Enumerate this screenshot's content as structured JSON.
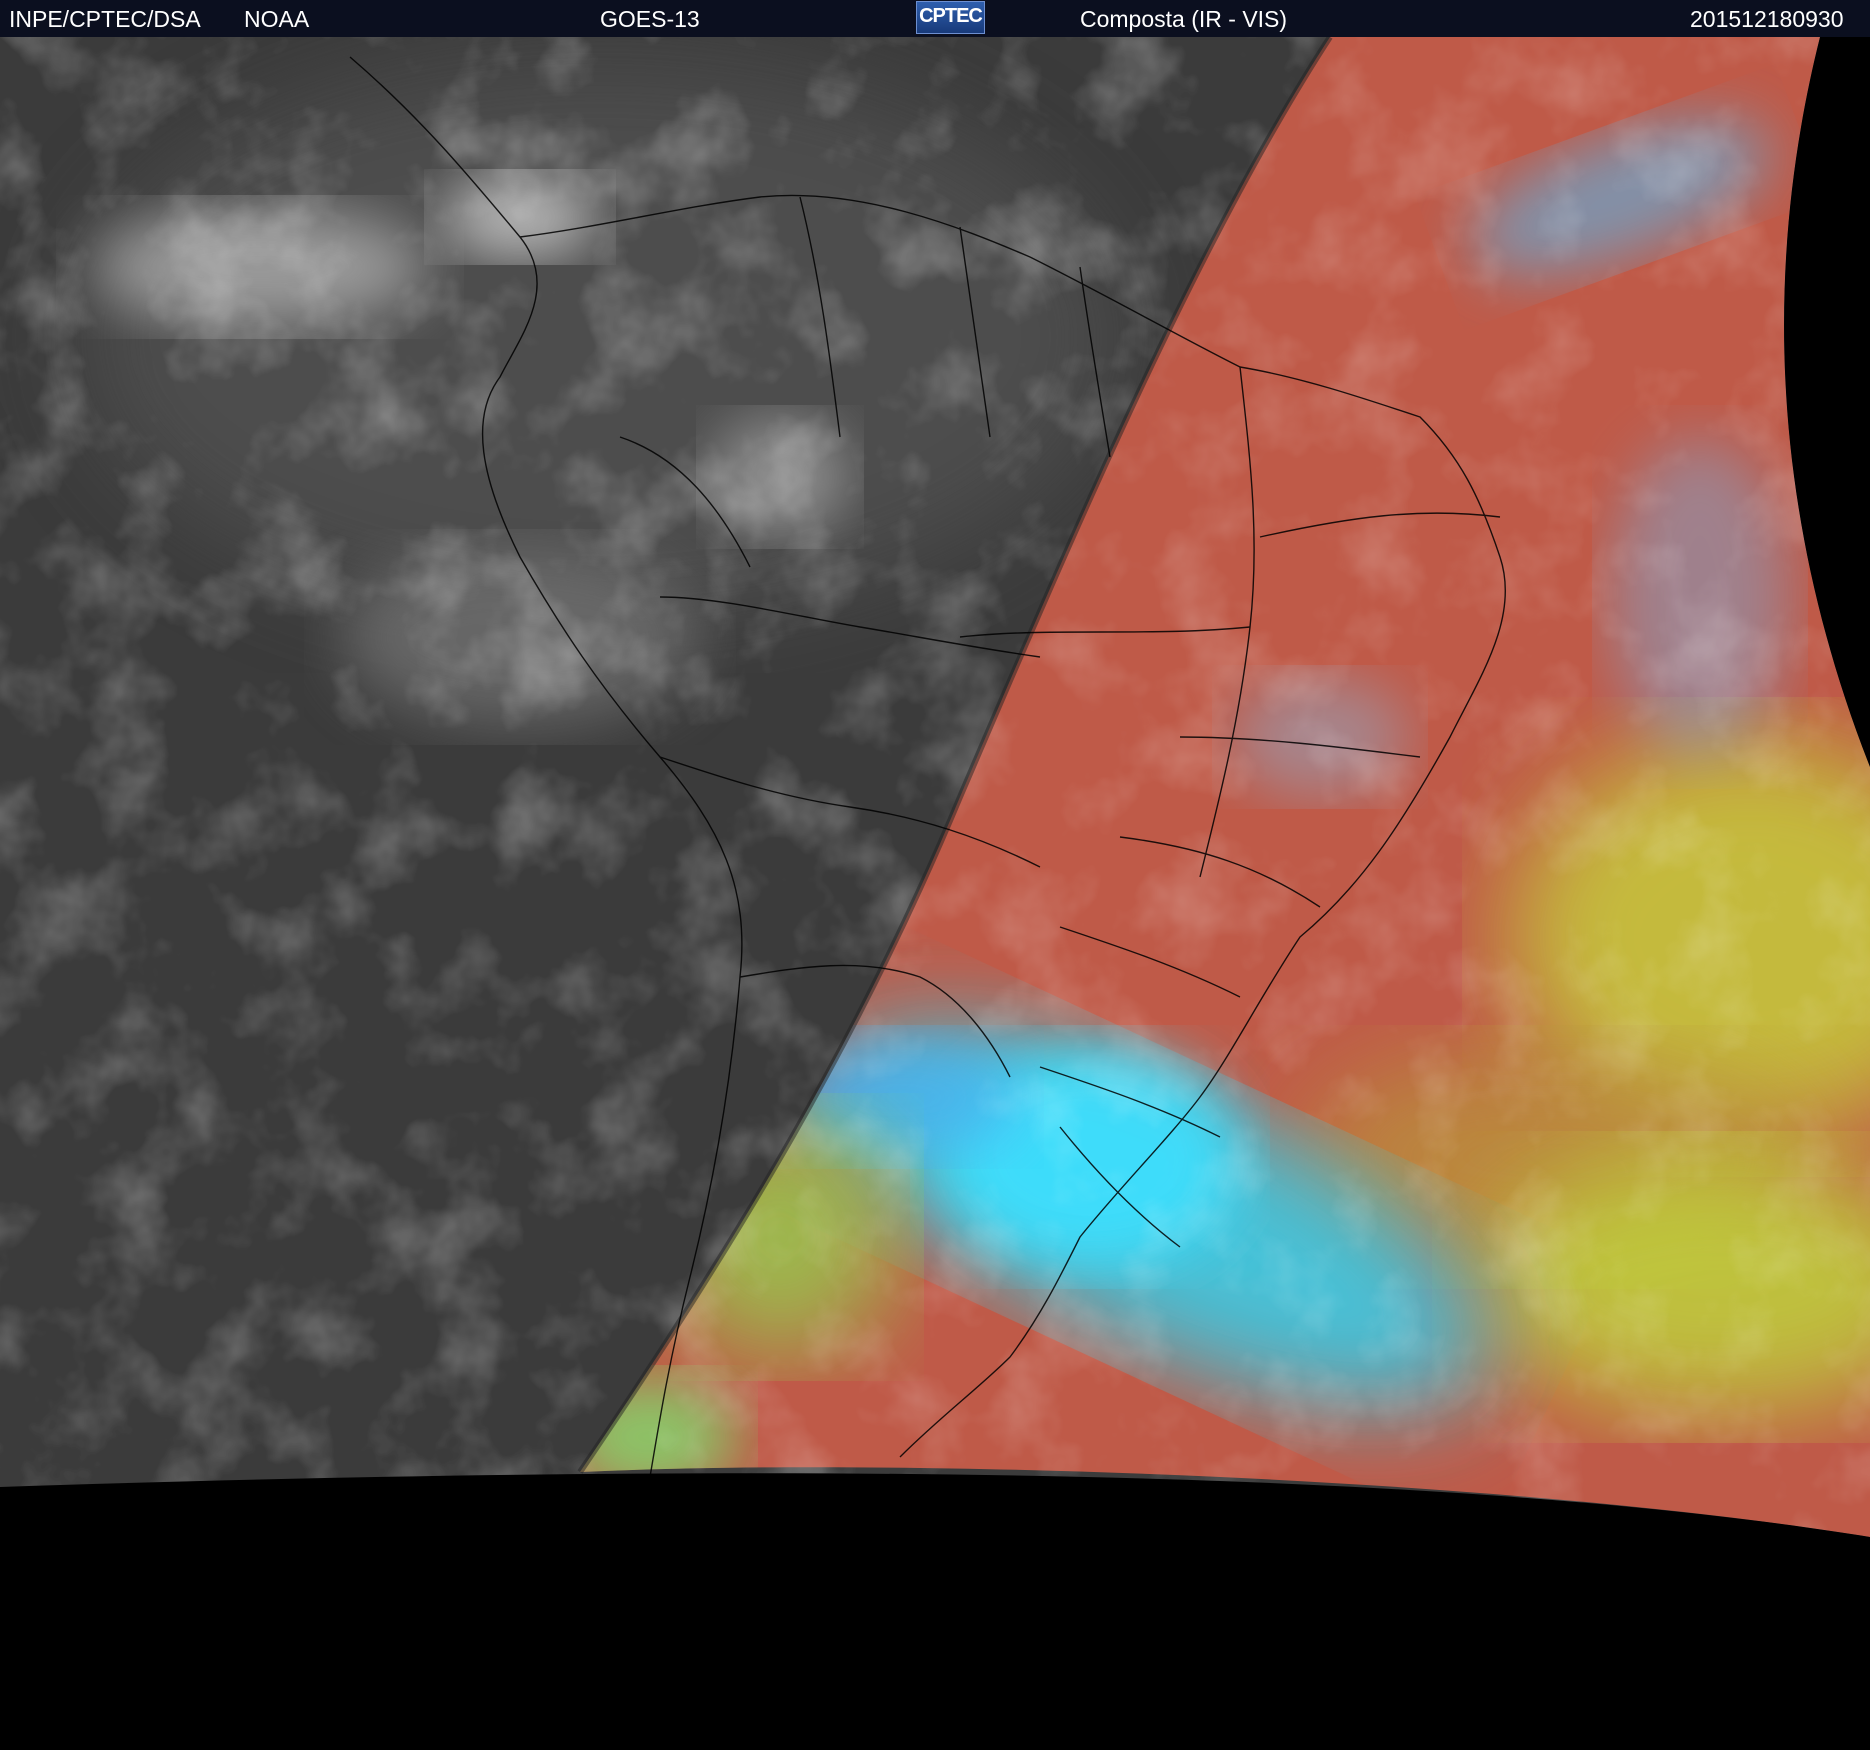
{
  "header": {
    "source": "INPE/CPTEC/DSA",
    "agency": "NOAA",
    "satellite": "GOES-13",
    "logo_text": "CPTEC",
    "product": "Composta (IR - VIS)",
    "timestamp": "201512180930"
  },
  "map": {
    "region": "South America",
    "night_side": "infrared grayscale",
    "day_side": "visible false-color composite",
    "colors": {
      "background": "#000000",
      "night_base": "#3a3a3a",
      "day_base": "#c05a4a",
      "cold_cloud": "#35d6f0",
      "low_cloud": "#b8e83a",
      "borders": "#000000"
    }
  }
}
